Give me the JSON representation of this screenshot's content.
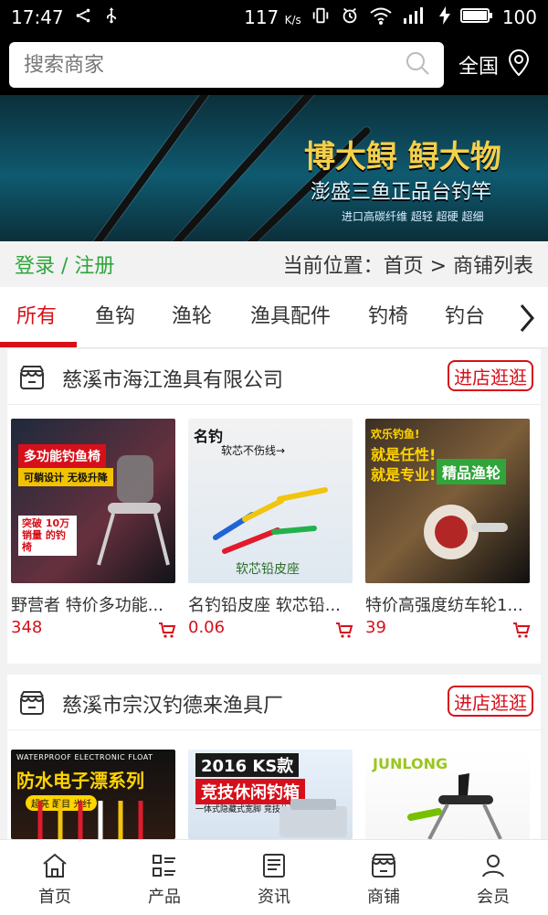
{
  "status": {
    "time": "17:47",
    "speed": "117",
    "speed_unit": "K/s",
    "battery": "100"
  },
  "search": {
    "placeholder": "搜索商家",
    "region": "全国"
  },
  "banner": {
    "title": "博大鲟 鲟大物",
    "subtitle": "澎盛三鱼正品台钓竿",
    "small": "进口高碳纤维 超轻 超硬 超细"
  },
  "crumb": {
    "login": "登录 / 注册",
    "location": "当前位置：首页 > 商铺列表"
  },
  "tabs": [
    "所有",
    "鱼钩",
    "渔轮",
    "渔具配件",
    "钓椅",
    "钓台"
  ],
  "shops": [
    {
      "name": "慈溪市海江渔具有限公司",
      "enter": "进店逛逛",
      "products": [
        {
          "title": "野营者 特价多功能...",
          "price": "348"
        },
        {
          "title": "名钓铅皮座 软芯铅...",
          "price": "0.06"
        },
        {
          "title": "特价高强度纺车轮1...",
          "price": "39"
        }
      ]
    },
    {
      "name": "慈溪市宗汉钓德来渔具厂",
      "enter": "进店逛逛",
      "products": [
        {
          "title": "",
          "price": ""
        },
        {
          "title": "",
          "price": ""
        },
        {
          "title": "",
          "price": ""
        }
      ]
    }
  ],
  "product_image_text": {
    "p1_1": "多功能钓鱼椅",
    "p1_2": "可躺设计 无极升降",
    "p1_3": "突破 10万销量 的钓椅",
    "p2_1": "名钓",
    "p2_2": "软芯不伤线→",
    "p2_3": "软芯铅皮座",
    "p3_1": "欢乐钓鱼!",
    "p3_2": "就是任性!",
    "p3_3": "就是专业!",
    "p3_4": "精品渔轮",
    "p4_1": "WATERPROOF ELECTRONIC FLOAT",
    "p4_2": "防水电子漂系列",
    "p4_3": "超亮 醒目 光纤",
    "p5_1": "2016 KS款",
    "p5_2": "竞技休闲钓箱",
    "p5_3": "一体式隐藏式宽脚 竞技休闲钓鱼箱",
    "p6_1": "JUNLONG"
  },
  "bottom_nav": [
    "首页",
    "产品",
    "资讯",
    "商铺",
    "会员"
  ],
  "colors": {
    "accent_red": "#d6101a",
    "login_green": "#2fa53a"
  }
}
